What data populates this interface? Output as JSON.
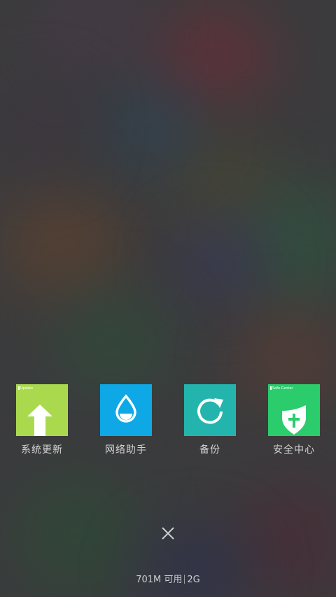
{
  "apps": [
    {
      "label": "系统更新",
      "tile_caption": "Update",
      "color": "#abd94e",
      "icon": "up-arrow-icon"
    },
    {
      "label": "网络助手",
      "tile_caption": "",
      "color": "#0ea8e6",
      "icon": "water-drop-icon"
    },
    {
      "label": "备份",
      "tile_caption": "",
      "color": "#23b5ad",
      "icon": "refresh-icon"
    },
    {
      "label": "安全中心",
      "tile_caption": "Safe Center",
      "color": "#2bcc6c",
      "icon": "shield-icon"
    }
  ],
  "close_icon": "close-icon",
  "memory": {
    "available": "701M 可用",
    "total": "2G"
  }
}
